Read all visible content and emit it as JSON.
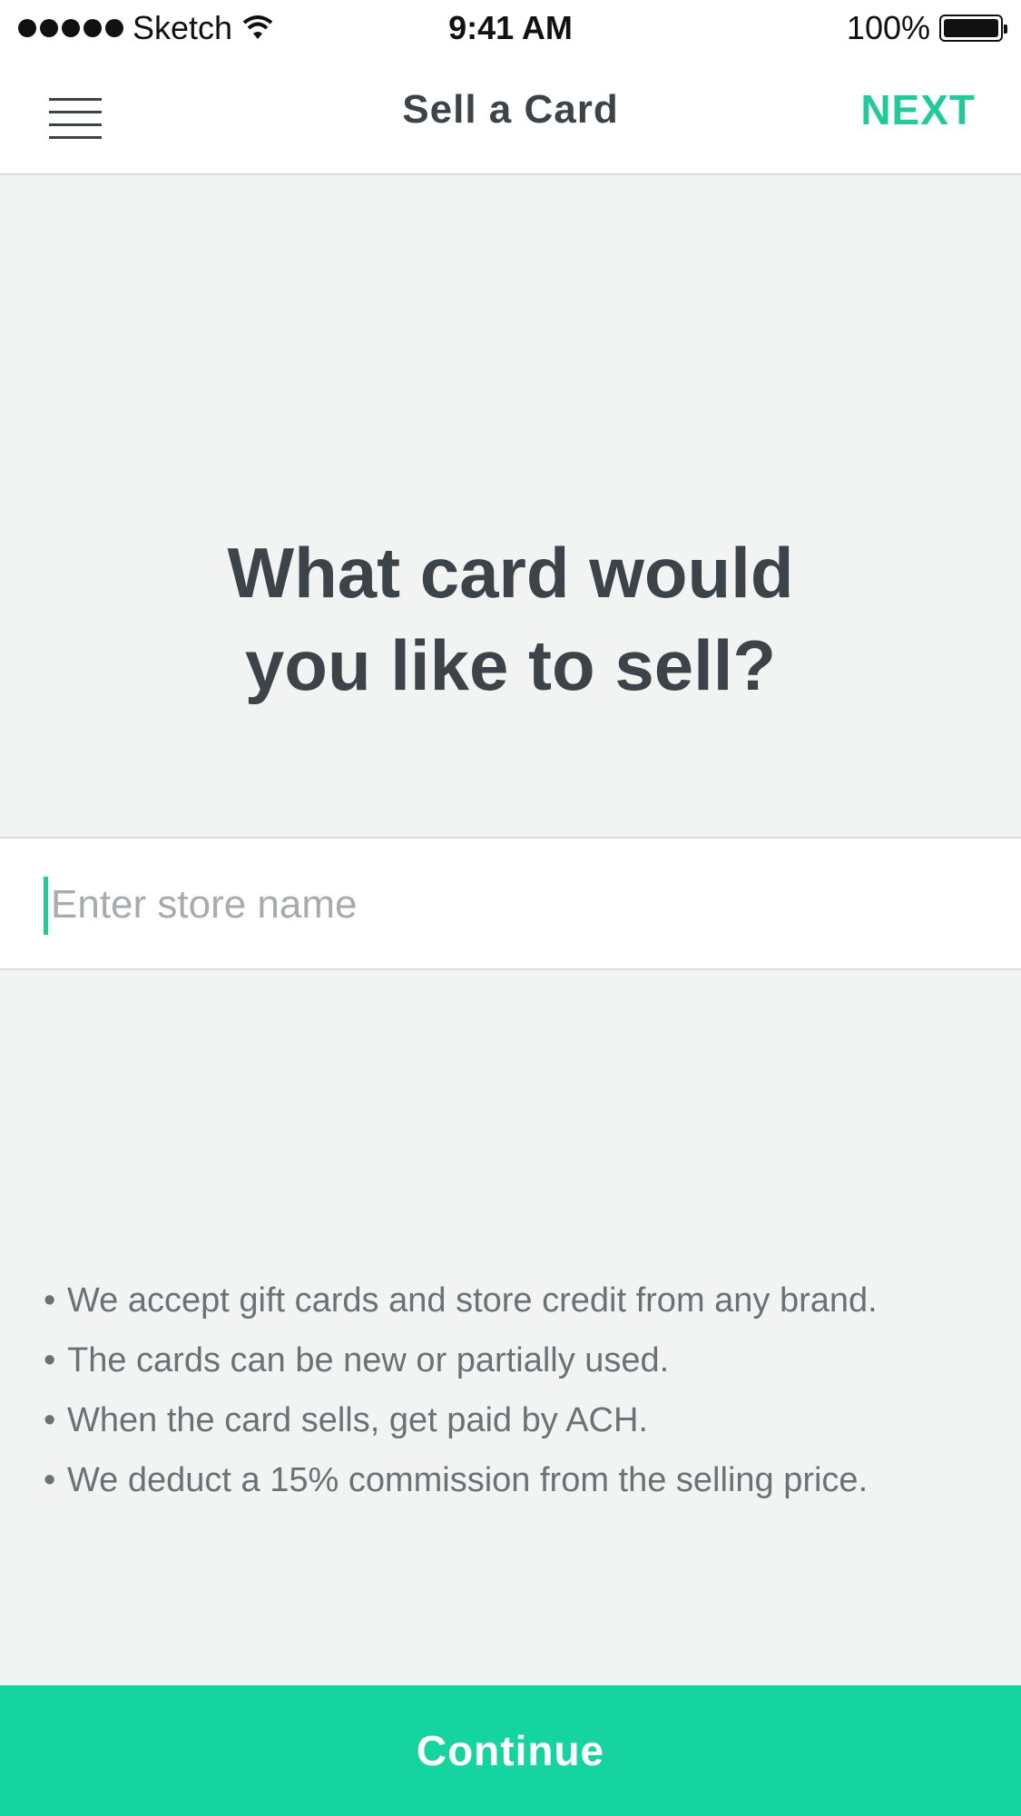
{
  "status_bar": {
    "carrier": "Sketch",
    "time": "9:41 AM",
    "battery": "100%",
    "battery_level": 1.0,
    "signal_icon": "signal-dots-icon",
    "wifi_icon": "wifi-icon",
    "battery_icon": "battery-icon"
  },
  "nav": {
    "menu_icon": "hamburger-menu-icon",
    "title": "Sell a Card",
    "next_label": "NEXT"
  },
  "main": {
    "question_line1": "What card would",
    "question_line2": "you like to sell?",
    "search_placeholder": "Enter store name",
    "search_value": ""
  },
  "info": {
    "bullet": "•",
    "items": [
      "We accept gift cards and store credit from any brand.",
      "The cards can be new or partially used.",
      "When the card sells, get paid by ACH.",
      "We deduct a 15% commission from the selling price."
    ]
  },
  "footer": {
    "continue_label": "Continue"
  },
  "colors": {
    "accent": "#23c99b",
    "button_bg": "#15d49f",
    "background": "#f2f4f4",
    "text_dark": "#3c4449",
    "text_muted": "#6b7175"
  }
}
